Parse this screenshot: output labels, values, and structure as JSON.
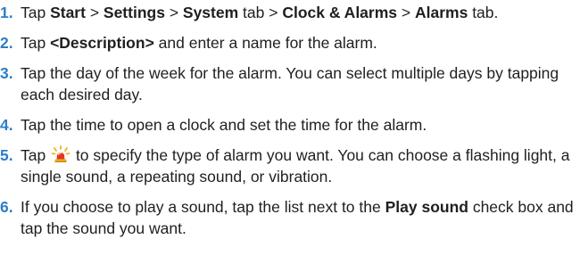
{
  "steps": [
    {
      "number": "1.",
      "parts": [
        "Tap ",
        "Start",
        " > ",
        "Settings",
        " > ",
        "System",
        " tab > ",
        "Clock & Alarms",
        " > ",
        "Alarms",
        " tab."
      ]
    },
    {
      "number": "2.",
      "parts": [
        "Tap ",
        "<Description>",
        " and enter a name for the alarm."
      ]
    },
    {
      "number": "3.",
      "text": "Tap the day of the week for the alarm. You can select multiple days by tapping each desired day."
    },
    {
      "number": "4.",
      "text": "Tap the time to open a clock and set the time for the alarm."
    },
    {
      "number": "5.",
      "before_icon": "Tap ",
      "icon": "alarm-light-icon",
      "after_icon": " to specify the type of alarm you want. You can choose a flashing light, a single sound, a repeating sound, or vibration."
    },
    {
      "number": "6.",
      "parts": [
        "If you choose to play a sound, tap the list next to the ",
        "Play sound",
        " check box and tap the sound you want."
      ]
    }
  ],
  "colors": {
    "step_number": "#2c7ec6",
    "text": "#1f1f1f",
    "icon_light": "#e03a1e",
    "icon_rays": "#f2b51c"
  }
}
